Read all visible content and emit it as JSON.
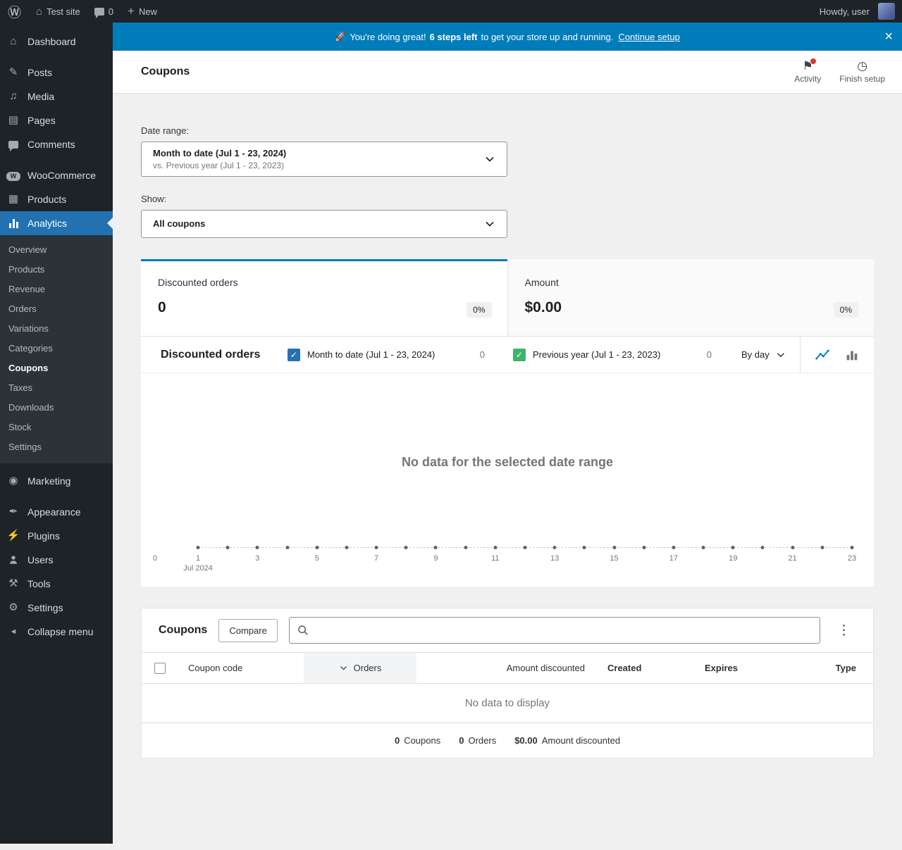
{
  "colors": {
    "accent_blue": "#2271b1",
    "banner_blue": "#007cba",
    "sidebar_bg": "#1d2327",
    "selected_tile_border": "#007cba",
    "series_current": "#2671b2",
    "series_previous": "#3db46a",
    "notification_red": "#d63638"
  },
  "admin_bar": {
    "wp_logo_icon": "Ⓦ",
    "home_icon": "⌂",
    "site_name": "Test site",
    "comments_count": "0",
    "plus_icon": "+",
    "new_label": "New",
    "howdy_text": "Howdy, user"
  },
  "banner": {
    "emoji": "🚀",
    "lead": "You're doing great!",
    "bold": "6 steps left",
    "rest": "to get your store up and running.",
    "cta": "Continue setup",
    "close_icon": "×"
  },
  "page_header": {
    "title": "Coupons",
    "activity": {
      "label": "Activity",
      "icon": "⚑"
    },
    "finish_setup": {
      "label": "Finish setup",
      "icon": "◷"
    }
  },
  "sidebar": {
    "items": [
      {
        "label": "Dashboard",
        "icon": "⌂"
      },
      {
        "label": "Posts",
        "icon": "✎"
      },
      {
        "label": "Media",
        "icon": "♫"
      },
      {
        "label": "Pages",
        "icon": "▤"
      },
      {
        "label": "Comments",
        "icon": ""
      },
      {
        "label": "WooCommerce",
        "icon": "W"
      },
      {
        "label": "Products",
        "icon": "▦"
      },
      {
        "label": "Analytics",
        "icon": ""
      },
      {
        "label": "Marketing",
        "icon": "◉"
      },
      {
        "label": "Appearance",
        "icon": "✒"
      },
      {
        "label": "Plugins",
        "icon": "⚡"
      },
      {
        "label": "Users",
        "icon": ""
      },
      {
        "label": "Tools",
        "icon": "⚒"
      },
      {
        "label": "Settings",
        "icon": "⚙"
      },
      {
        "label": "Collapse menu",
        "icon": "◄"
      }
    ],
    "analytics_submenu": [
      "Overview",
      "Products",
      "Revenue",
      "Orders",
      "Variations",
      "Categories",
      "Coupons",
      "Taxes",
      "Downloads",
      "Stock",
      "Settings"
    ],
    "active_item": "Analytics",
    "active_submenu": "Coupons"
  },
  "filters": {
    "date_range_label": "Date range:",
    "date_range_primary": "Month to date (Jul 1 - 23, 2024)",
    "date_range_secondary": "vs. Previous year (Jul 1 - 23, 2023)",
    "show_label": "Show:",
    "show_value": "All coupons"
  },
  "summary_tiles": [
    {
      "label": "Discounted orders",
      "value": "0",
      "delta": "0%"
    },
    {
      "label": "Amount",
      "value": "$0.00",
      "delta": "0%"
    }
  ],
  "chart": {
    "title": "Discounted orders",
    "legend": [
      {
        "label": "Month to date (Jul 1 - 23, 2024)",
        "count": "0",
        "checked": true,
        "color": "#2671b2",
        "check_icon": "✓"
      },
      {
        "label": "Previous year (Jul 1 - 23, 2023)",
        "count": "0",
        "checked": true,
        "color": "#3db46a",
        "check_icon": "✓"
      }
    ],
    "interval": "By day",
    "empty_message": "No data for the selected date range",
    "y_zero_label": "0",
    "x_month_label": "Jul 2024"
  },
  "chart_data": {
    "type": "line",
    "title": "Discounted orders",
    "interval": "By day",
    "x": [
      1,
      2,
      3,
      4,
      5,
      6,
      7,
      8,
      9,
      10,
      11,
      12,
      13,
      14,
      15,
      16,
      17,
      18,
      19,
      20,
      21,
      22,
      23
    ],
    "x_tick_labels": [
      "1",
      "3",
      "5",
      "7",
      "9",
      "11",
      "13",
      "15",
      "17",
      "19",
      "21",
      "23"
    ],
    "x_month_label": "Jul 2024",
    "series": [
      {
        "name": "Month to date (Jul 1 - 23, 2024)",
        "values": [
          0,
          0,
          0,
          0,
          0,
          0,
          0,
          0,
          0,
          0,
          0,
          0,
          0,
          0,
          0,
          0,
          0,
          0,
          0,
          0,
          0,
          0,
          0
        ]
      },
      {
        "name": "Previous year (Jul 1 - 23, 2023)",
        "values": [
          0,
          0,
          0,
          0,
          0,
          0,
          0,
          0,
          0,
          0,
          0,
          0,
          0,
          0,
          0,
          0,
          0,
          0,
          0,
          0,
          0,
          0,
          0
        ]
      }
    ],
    "y_ticks": [
      "0"
    ],
    "ylim": [
      0,
      1
    ],
    "empty_message": "No data for the selected date range"
  },
  "table": {
    "title": "Coupons",
    "compare_label": "Compare",
    "search_placeholder": "",
    "menu_icon": "⋮",
    "columns": [
      {
        "label": "Coupon code",
        "sorted": false
      },
      {
        "label": "Orders",
        "sorted": true
      },
      {
        "label": "Amount discounted",
        "sorted": false
      },
      {
        "label": "Created",
        "sorted": false
      },
      {
        "label": "Expires",
        "sorted": false
      },
      {
        "label": "Type",
        "sorted": false
      }
    ],
    "empty_message": "No data to display",
    "summary": [
      {
        "value": "0",
        "label": "Coupons"
      },
      {
        "value": "0",
        "label": "Orders"
      },
      {
        "value": "$0.00",
        "label": "Amount discounted"
      }
    ]
  }
}
